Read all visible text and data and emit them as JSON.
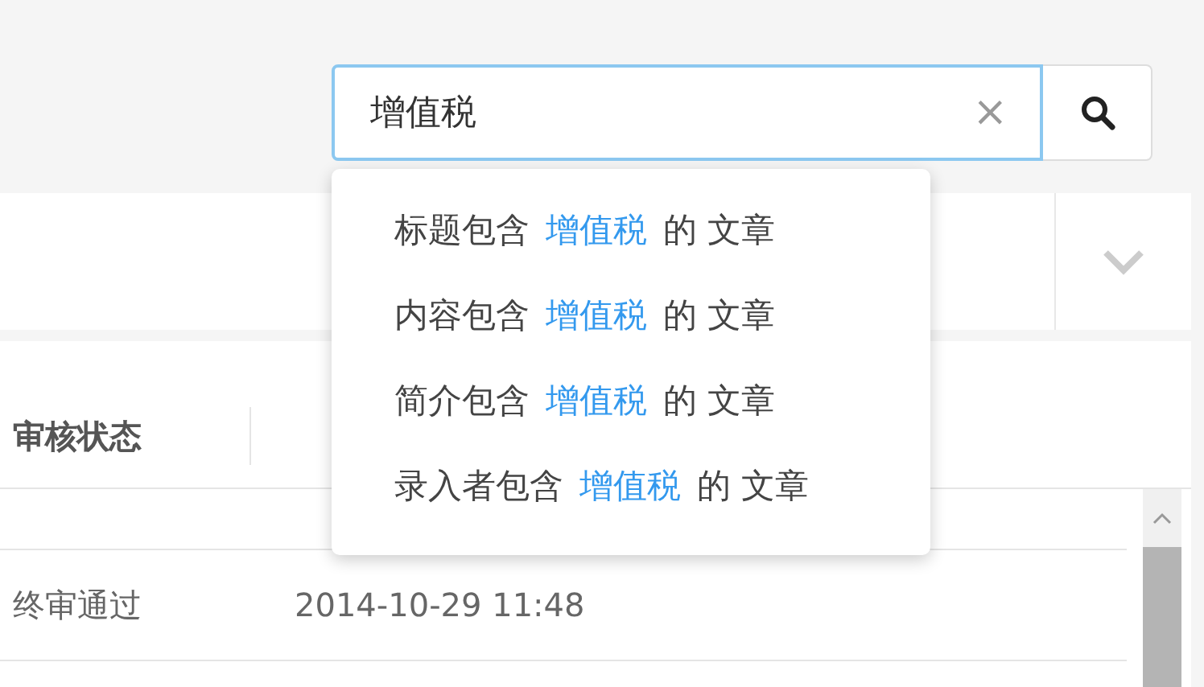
{
  "search": {
    "value": "增值税",
    "clear": "×"
  },
  "suggestions": [
    {
      "prefix": "标题包含",
      "keyword": "增值税",
      "suffix": "的 文章"
    },
    {
      "prefix": "内容包含",
      "keyword": "增值税",
      "suffix": "的 文章"
    },
    {
      "prefix": "简介包含",
      "keyword": "增值税",
      "suffix": "的 文章"
    },
    {
      "prefix": "录入者包含",
      "keyword": "增值税",
      "suffix": "的 文章"
    }
  ],
  "table": {
    "columns": [
      "审核状态"
    ],
    "rows": [
      {
        "status": "终审通过",
        "time": "2014-10-29 11:48"
      }
    ]
  }
}
